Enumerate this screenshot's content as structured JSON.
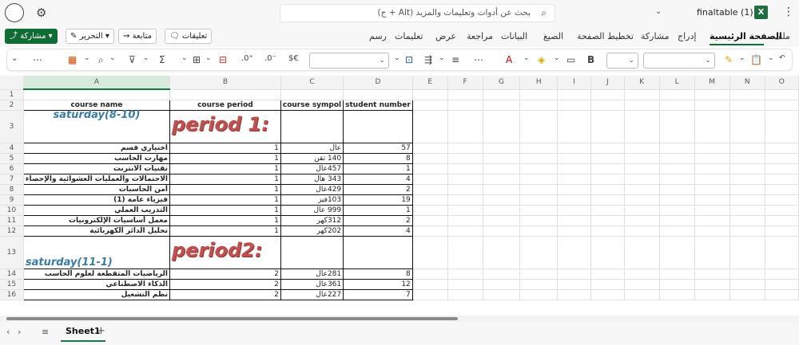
{
  "titlebar": {
    "search_placeholder": "بحث عن أدوات وتعليمات والمزيد (Alt + ج)",
    "filename": "finaltable (1)",
    "excel_label": "X"
  },
  "ribbon": {
    "share_label": "مشاركة",
    "editing_label": "التحرير",
    "follow_label": "متابعة",
    "comments_label": "تعليقات",
    "tabs": [
      "ملف",
      "الصفحة الرئيسية",
      "إدراج",
      "مشاركة",
      "تخطيط الصفحة",
      "الصيغ",
      "البيانات",
      "مراجعة",
      "عرض",
      "تعليمات",
      "رسم"
    ],
    "active_tab": "الصفحة الرئيسية"
  },
  "toolbar": {
    "bold": "B",
    "currency": "$€"
  },
  "grid": {
    "columns": [
      "A",
      "B",
      "C",
      "D",
      "E",
      "F",
      "G",
      "H",
      "I",
      "J",
      "K",
      "L",
      "M",
      "N",
      "O"
    ],
    "rows": [
      {
        "n": "1"
      },
      {
        "n": "2",
        "a": "course name",
        "b": "course period",
        "c": "course sympol",
        "d": "student number"
      },
      {
        "n": "3",
        "sat": "saturday(8-10)",
        "period": "period 1:"
      },
      {
        "n": "4",
        "a": "اختياري قسم",
        "b": "1",
        "c": "عال",
        "d": "57"
      },
      {
        "n": "5",
        "a": "مهارت الحاسب",
        "b": "1",
        "c": "140 تقن",
        "d": "8"
      },
      {
        "n": "6",
        "a": "تقنيات الانترنت",
        "b": "1",
        "c": "457عال",
        "d": "1"
      },
      {
        "n": "7",
        "a": "الاحتمالات والعمليات العشوائية والإحصاء",
        "b": "1",
        "c": "343 هال",
        "d": "4"
      },
      {
        "n": "8",
        "a": "أمن الحاسبات",
        "b": "1",
        "c": "429عال",
        "d": "2"
      },
      {
        "n": "9",
        "a": "فيزياء عامة (1)",
        "b": "1",
        "c": "103فيز",
        "d": "19"
      },
      {
        "n": "10",
        "a": "التدريب العملي",
        "b": "1",
        "c": "999 عال",
        "d": "1"
      },
      {
        "n": "11",
        "a": "معمل أساسيات الإلكترونيات",
        "b": "1",
        "c": "312كهر",
        "d": "2"
      },
      {
        "n": "12",
        "a": "تحليل الدائر الكهربائية",
        "b": "1",
        "c": "202كهر",
        "d": "4"
      },
      {
        "n": "13",
        "sat": "saturday(11-1)",
        "period": "period2:"
      },
      {
        "n": "14",
        "a": "الرياضيات المتقطعة لعلوم الحاسب",
        "b": "2",
        "c": "281عال",
        "d": "8"
      },
      {
        "n": "15",
        "a": "الذكاء الاصطناعي",
        "b": "2",
        "c": "361عال",
        "d": "12"
      },
      {
        "n": "16",
        "a": "نظم التشغيل",
        "b": "2",
        "c": "227عال",
        "d": "7"
      }
    ]
  },
  "sheets": {
    "active": "Sheet1",
    "add_label": "+"
  }
}
